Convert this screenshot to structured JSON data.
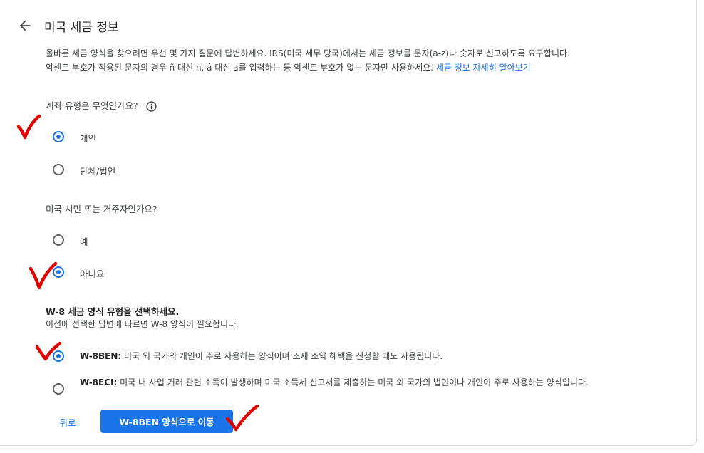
{
  "header": {
    "title": "미국 세금 정보"
  },
  "intro": {
    "line1": "올바른 세금 양식을 찾으려면 우선 몇 가지 질문에 답변하세요. IRS(미국 세무 당국)에서는 세금 정보를 문자(a-z)나 숫자로 신고하도록 요구합니다.",
    "line2": "악센트 부호가 적용된 문자의 경우 ñ 대신 n, á 대신 a를 입력하는 등 악센트 부호가 없는 문자만 사용하세요.",
    "link": "세금 정보 자세히 알아보기"
  },
  "account_type": {
    "question": "계좌 유형은 무엇인가요?",
    "options": [
      {
        "label": "개인",
        "selected": true
      },
      {
        "label": "단체/법인",
        "selected": false
      }
    ]
  },
  "us_person": {
    "question": "미국 시민 또는 거주자인가요?",
    "options": [
      {
        "label": "예",
        "selected": false
      },
      {
        "label": "아니요",
        "selected": true
      }
    ]
  },
  "w8_form": {
    "title": "W-8 세금 양식 유형을 선택하세요.",
    "subtitle": "이전에 선택한 답변에 따르면 W-8 양식이 필요합니다.",
    "options": [
      {
        "code": "W-8BEN:",
        "desc": "미국 외 국가의 개인이 주로 사용하는 양식이며 조세 조약 혜택을 신청할 때도 사용됩니다.",
        "selected": true
      },
      {
        "code": "W-8ECI:",
        "desc": "미국 내 사업 거래 관련 소득이 발생하며 미국 소득세 신고서를 제출하는 미국 외 국가의 법인이나 개인이 주로 사용하는 양식입니다.",
        "selected": false
      }
    ]
  },
  "actions": {
    "back_label": "뒤로",
    "primary_label": "W-8BEN 양식으로 이동"
  },
  "colors": {
    "accent": "#1a73e8",
    "annotation": "#e00000"
  }
}
